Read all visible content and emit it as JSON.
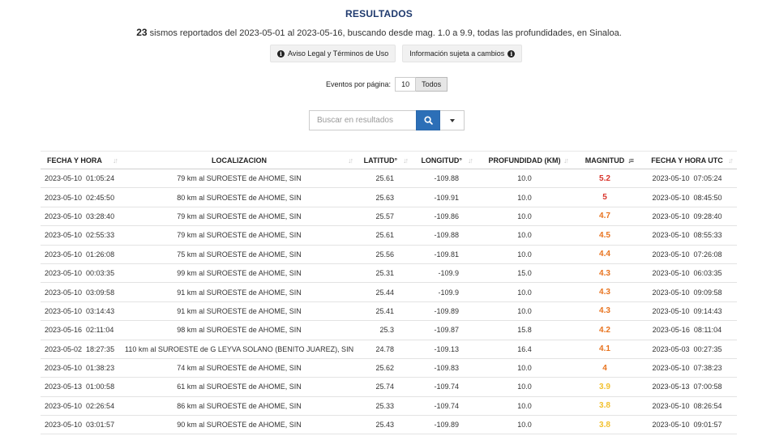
{
  "header": {
    "title": "RESULTADOS",
    "count": "23",
    "summary_text": " sismos reportados del 2023-05-01 al 2023-05-16, buscando desde mag. 1.0 a 9.9, todas las profundidades, en Sinaloa."
  },
  "buttons": {
    "aviso_label": "Aviso Legal y Términos de Uso",
    "info_label": "Información sujeta a cambios"
  },
  "perpage": {
    "label": "Eventos por página:",
    "options": [
      "10",
      "Todos"
    ],
    "active": "Todos"
  },
  "search": {
    "placeholder": "Buscar en resultados"
  },
  "table": {
    "columns": [
      "FECHA Y HORA",
      "LOCALIZACION",
      "LATITUD°",
      "LONGITUD°",
      "PROFUNDIDAD (KM)",
      "MAGNITUD",
      "FECHA Y HORA UTC"
    ],
    "sorted_column": "MAGNITUD",
    "rows": [
      {
        "fecha": "2023-05-10  01:05:24",
        "loc": "79 km al SUROESTE de AHOME, SIN",
        "lat": "25.61",
        "lon": "-109.88",
        "prof": "10.0",
        "mag": "5.2",
        "mag_color": "#d9342b",
        "utc": "2023-05-10  07:05:24"
      },
      {
        "fecha": "2023-05-10  02:45:50",
        "loc": "80 km al SUROESTE de AHOME, SIN",
        "lat": "25.63",
        "lon": "-109.91",
        "prof": "10.0",
        "mag": "5",
        "mag_color": "#d9342b",
        "utc": "2023-05-10  08:45:50"
      },
      {
        "fecha": "2023-05-10  03:28:40",
        "loc": "79 km al SUROESTE de AHOME, SIN",
        "lat": "25.57",
        "lon": "-109.86",
        "prof": "10.0",
        "mag": "4.7",
        "mag_color": "#e8731e",
        "utc": "2023-05-10  09:28:40"
      },
      {
        "fecha": "2023-05-10  02:55:33",
        "loc": "79 km al SUROESTE de AHOME, SIN",
        "lat": "25.61",
        "lon": "-109.88",
        "prof": "10.0",
        "mag": "4.5",
        "mag_color": "#e8731e",
        "utc": "2023-05-10  08:55:33"
      },
      {
        "fecha": "2023-05-10  01:26:08",
        "loc": "75 km al SUROESTE de AHOME, SIN",
        "lat": "25.56",
        "lon": "-109.81",
        "prof": "10.0",
        "mag": "4.4",
        "mag_color": "#e8731e",
        "utc": "2023-05-10  07:26:08"
      },
      {
        "fecha": "2023-05-10  00:03:35",
        "loc": "99 km al SUROESTE de AHOME, SIN",
        "lat": "25.31",
        "lon": "-109.9",
        "prof": "15.0",
        "mag": "4.3",
        "mag_color": "#e8731e",
        "utc": "2023-05-10  06:03:35"
      },
      {
        "fecha": "2023-05-10  03:09:58",
        "loc": "91 km al SUROESTE de AHOME, SIN",
        "lat": "25.44",
        "lon": "-109.9",
        "prof": "10.0",
        "mag": "4.3",
        "mag_color": "#e8731e",
        "utc": "2023-05-10  09:09:58"
      },
      {
        "fecha": "2023-05-10  03:14:43",
        "loc": "91 km al SUROESTE de AHOME, SIN",
        "lat": "25.41",
        "lon": "-109.89",
        "prof": "10.0",
        "mag": "4.3",
        "mag_color": "#e8731e",
        "utc": "2023-05-10  09:14:43"
      },
      {
        "fecha": "2023-05-16  02:11:04",
        "loc": "98 km al SUROESTE de AHOME, SIN",
        "lat": "25.3",
        "lon": "-109.87",
        "prof": "15.8",
        "mag": "4.2",
        "mag_color": "#e8731e",
        "utc": "2023-05-16  08:11:04"
      },
      {
        "fecha": "2023-05-02  18:27:35",
        "loc": "110 km al SUROESTE de G LEYVA SOLANO (BENITO JUAREZ), SIN",
        "lat": "24.78",
        "lon": "-109.13",
        "prof": "16.4",
        "mag": "4.1",
        "mag_color": "#e8731e",
        "utc": "2023-05-03  00:27:35"
      },
      {
        "fecha": "2023-05-10  01:38:23",
        "loc": "74 km al SUROESTE de AHOME, SIN",
        "lat": "25.62",
        "lon": "-109.83",
        "prof": "10.0",
        "mag": "4",
        "mag_color": "#e8731e",
        "utc": "2023-05-10  07:38:23"
      },
      {
        "fecha": "2023-05-13  01:00:58",
        "loc": "61 km al SUROESTE de AHOME, SIN",
        "lat": "25.74",
        "lon": "-109.74",
        "prof": "10.0",
        "mag": "3.9",
        "mag_color": "#f2c12e",
        "utc": "2023-05-13  07:00:58"
      },
      {
        "fecha": "2023-05-10  02:26:54",
        "loc": "86 km al SUROESTE de AHOME, SIN",
        "lat": "25.33",
        "lon": "-109.74",
        "prof": "10.0",
        "mag": "3.8",
        "mag_color": "#f2c12e",
        "utc": "2023-05-10  08:26:54"
      },
      {
        "fecha": "2023-05-10  03:01:57",
        "loc": "90 km al SUROESTE de AHOME, SIN",
        "lat": "25.43",
        "lon": "-109.89",
        "prof": "10.0",
        "mag": "3.8",
        "mag_color": "#f2c12e",
        "utc": "2023-05-10  09:01:57"
      }
    ]
  }
}
